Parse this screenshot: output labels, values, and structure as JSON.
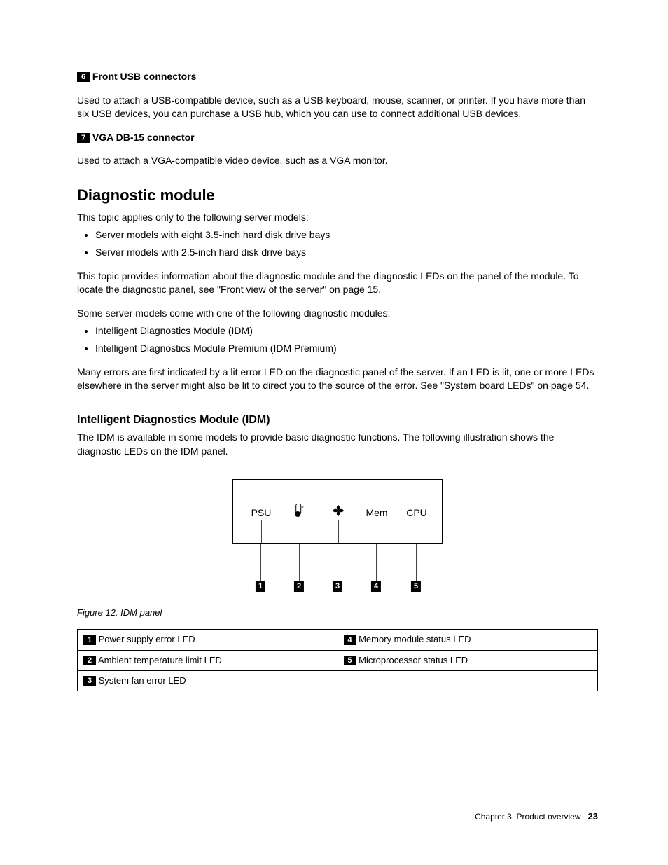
{
  "section6": {
    "num": "6",
    "title": "Front USB connectors",
    "body": "Used to attach a USB-compatible device, such as a USB keyboard, mouse, scanner, or printer. If you have more than six USB devices, you can purchase a USB hub, which you can use to connect additional USB devices."
  },
  "section7": {
    "num": "7",
    "title": "VGA DB-15 connector",
    "body": "Used to attach a VGA-compatible video device, such as a VGA monitor."
  },
  "diag": {
    "heading": "Diagnostic module",
    "intro": "This topic applies only to the following server models:",
    "models": [
      "Server models with eight 3.5-inch hard disk drive bays",
      "Server models with 2.5-inch hard disk drive bays"
    ],
    "p2": "This topic provides information about the diagnostic module and the diagnostic LEDs on the panel of the module. To locate the diagnostic panel, see \"Front view of the server\" on page 15.",
    "p3": "Some server models come with one of the following diagnostic modules:",
    "modules": [
      "Intelligent Diagnostics Module (IDM)",
      "Intelligent Diagnostics Module Premium (IDM Premium)"
    ],
    "p4": "Many errors are first indicated by a lit error LED on the diagnostic panel of the server. If an LED is lit, one or more LEDs elsewhere in the server might also be lit to direct you to the source of the error. See \"System board LEDs\" on page 54."
  },
  "idm": {
    "heading": "Intelligent Diagnostics Module (IDM)",
    "intro": "The IDM is available in some models to provide basic diagnostic functions. The following illustration shows the diagnostic LEDs on the IDM panel.",
    "figcaption": "Figure 12.  IDM panel",
    "panel": {
      "psu": "PSU",
      "mem": "Mem",
      "cpu": "CPU"
    },
    "callouts": {
      "1": "Power supply error LED",
      "2": "Ambient temperature limit LED",
      "3": "System fan error LED",
      "4": "Memory module status LED",
      "5": "Microprocessor status LED"
    }
  },
  "footer": {
    "chapter": "Chapter 3.  Product overview",
    "page": "23"
  }
}
